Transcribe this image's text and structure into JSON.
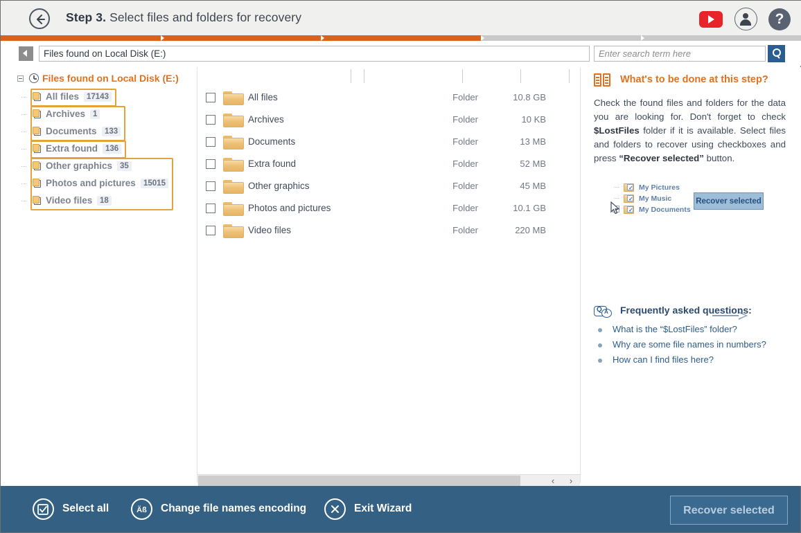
{
  "header": {
    "step_label": "Step 3.",
    "title": "Select files and folders for recovery",
    "back_icon": "back-arrow-icon",
    "youtube_icon": "youtube-icon",
    "account_icon": "user-account-icon",
    "help_icon": "help-question-icon",
    "accent_color": "#d9621f",
    "bg_color": "#f0f0ee"
  },
  "progress": {
    "percent": 60,
    "fill_color": "#d9621f",
    "track_color": "#c9c9c9"
  },
  "pathbar": {
    "back_button_icon": "left-triangle-icon",
    "path_value": "Files found on Local Disk (E:)",
    "search_placeholder": "Enter search term here",
    "search_value": "",
    "search_button_icon": "magnifier-icon",
    "search_button_color": "#2c5d8f"
  },
  "tree": {
    "root": {
      "label": "Files found on Local Disk (E:)",
      "icon": "clock-scan-icon",
      "expander": "collapse-minus-icon",
      "color": "#e2711d"
    },
    "items": [
      {
        "label": "All files",
        "count": "17143",
        "icon": "folder-stack-icon"
      },
      {
        "label": "Archives",
        "count": "1",
        "icon": "folder-stack-icon"
      },
      {
        "label": "Documents",
        "count": "133",
        "icon": "folder-stack-icon"
      },
      {
        "label": "Extra found",
        "count": "136",
        "icon": "folder-stack-icon"
      },
      {
        "label": "Other graphics",
        "count": "35",
        "icon": "folder-stack-icon"
      },
      {
        "label": "Photos and pictures",
        "count": "15015",
        "icon": "folder-stack-icon"
      },
      {
        "label": "Video files",
        "count": "18",
        "icon": "folder-stack-icon"
      }
    ],
    "highlight_color": "#e3a33a"
  },
  "filelist": {
    "columns": [
      "",
      "",
      "",
      ""
    ],
    "rows": [
      {
        "name": "All files",
        "type": "Folder",
        "size": "10.8 GB",
        "checked": false
      },
      {
        "name": "Archives",
        "type": "Folder",
        "size": "10 KB",
        "checked": false
      },
      {
        "name": "Documents",
        "type": "Folder",
        "size": "13 MB",
        "checked": false
      },
      {
        "name": "Extra found",
        "type": "Folder",
        "size": "52 MB",
        "checked": false
      },
      {
        "name": "Other graphics",
        "type": "Folder",
        "size": "45 MB",
        "checked": false
      },
      {
        "name": "Photos and pictures",
        "type": "Folder",
        "size": "10.1 GB",
        "checked": false
      },
      {
        "name": "Video files",
        "type": "Folder",
        "size": "220 MB",
        "checked": false
      }
    ],
    "scroll_left_arrow": "‹",
    "scroll_right_arrow": "›"
  },
  "help": {
    "icon": "open-book-icon",
    "title": "What's to be done at this step?",
    "body_part1": "Check the found files and folders for the data you are looking for. Don't forget to check ",
    "body_bold1": "$LostFiles",
    "body_part2": " folder if it is available. Select files and folders to recover using checkboxes and press ",
    "body_bold2": "“Recover selected”",
    "body_part3": " button.",
    "illustration": {
      "rows": [
        {
          "label": "My Pictures",
          "icon": "folder-checked-icon"
        },
        {
          "label": "My Music",
          "icon": "folder-checked-icon"
        },
        {
          "label": "My Documents",
          "icon": "folder-checked-icon"
        }
      ],
      "arrow_icon": "right-arrow-icon",
      "cursor_icon": "mouse-cursor-icon",
      "button_label": "Recover selected"
    }
  },
  "faq": {
    "icon": "question-answer-icon",
    "title": "Frequently asked questions:",
    "items": [
      "What is the “$LostFiles” folder?",
      "Why are some file names in numbers?",
      "How can I find files here?"
    ]
  },
  "bottom": {
    "bg_color": "#336083",
    "actions": [
      {
        "label": "Select all",
        "icon": "select-all-checkbox-icon"
      },
      {
        "label": "Change file names encoding",
        "icon": "encoding-ab-icon"
      },
      {
        "label": "Exit Wizard",
        "icon": "close-x-icon"
      }
    ],
    "primary_button": "Recover selected"
  }
}
